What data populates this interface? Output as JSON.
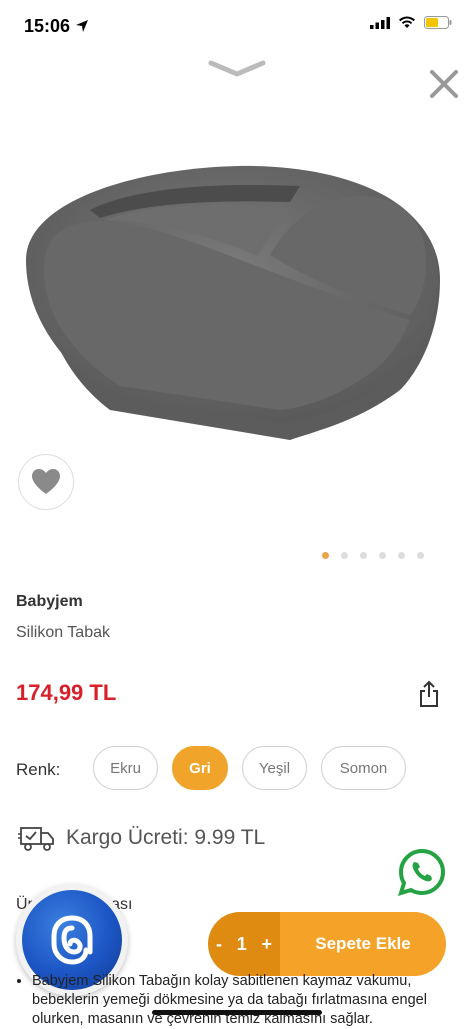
{
  "status_bar": {
    "time": "15:06"
  },
  "product": {
    "brand": "Babyjem",
    "name": "Silikon Tabak",
    "price": "174,99 TL"
  },
  "carousel": {
    "count": 6,
    "active_index": 0
  },
  "colors": {
    "label": "Renk:",
    "options": [
      {
        "label": "Ekru",
        "selected": false
      },
      {
        "label": "Gri",
        "selected": true
      },
      {
        "label": "Yeşil",
        "selected": false
      },
      {
        "label": "Somon",
        "selected": false
      }
    ]
  },
  "shipping": {
    "text": "Kargo Ücreti: 9.99 TL"
  },
  "section": {
    "title": "Ürün Açıklaması"
  },
  "cart": {
    "minus": "-",
    "quantity": "1",
    "plus": "+",
    "add_label": "Sepete Ekle"
  },
  "description": {
    "text": "Babyjem Silikon Tabağın kolay sabitlenen kaymaz vakumu, bebeklerin yemeği dökmesine ya da tabağı fırlatmasına engel olurken, masanın ve çevrenin temiz kalmasını sağlar."
  },
  "colors_theme": {
    "accent": "#f5a229",
    "price": "#d8202a",
    "whatsapp": "#25a244"
  },
  "icons": [
    "chevron-down-icon",
    "close-icon",
    "heart-icon",
    "share-icon",
    "truck-icon",
    "whatsapp-icon"
  ]
}
